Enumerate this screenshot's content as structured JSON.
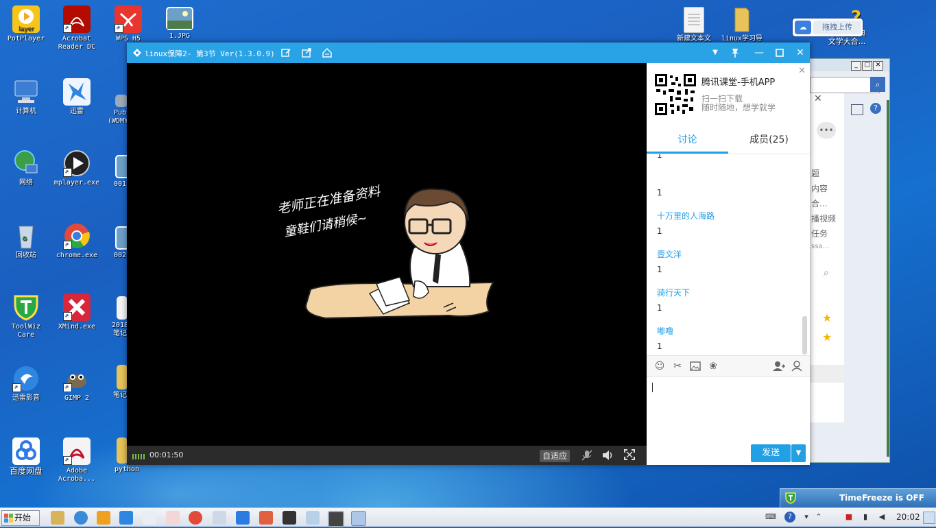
{
  "desktop_icons": [
    {
      "label": "PotPlayer",
      "icon": "potplayer-icon",
      "color": "#f7c51a"
    },
    {
      "label": "Acrobat\nReader DC",
      "icon": "acrobat-icon",
      "color": "#b30b00"
    },
    {
      "label": "WPS H5",
      "icon": "wps-icon",
      "color": "#e8352d"
    },
    {
      "label": "1.JPG",
      "icon": "image-file-icon",
      "color": "#6ca0c8"
    },
    {
      "label": "新建文本文",
      "icon": "text-file-icon",
      "color": "#f4f4f4"
    },
    {
      "label": "linux学习导",
      "icon": "folder-icon",
      "color": "#e8c35b"
    },
    {
      "label": "《中国古典\n文学大合...",
      "icon": "help-file-icon",
      "color": "#f2c21b"
    },
    {
      "label": "计算机",
      "icon": "computer-icon",
      "color": "#3b7ed4"
    },
    {
      "label": "迅雷",
      "icon": "xunlei-icon",
      "color": "#2f86e0"
    },
    {
      "label": "Pub\n(WDMYC",
      "icon": "network-share-icon",
      "color": "#9ab"
    },
    {
      "label": "网络",
      "icon": "network-icon",
      "color": "#3b9e48"
    },
    {
      "label": "mplayer.exe",
      "icon": "mplayer-icon",
      "color": "#222222"
    },
    {
      "label": "001",
      "icon": "image-file-icon",
      "color": "#6ca0c8"
    },
    {
      "label": "回收站",
      "icon": "recycle-bin-icon",
      "color": "#c8d8e8"
    },
    {
      "label": "chrome.exe",
      "icon": "chrome-icon",
      "color": "#e24a3b"
    },
    {
      "label": "002",
      "icon": "image-file-icon",
      "color": "#6ca0c8"
    },
    {
      "label": "ToolWiz\nCare",
      "icon": "toolwiz-icon",
      "color": "#2aa845"
    },
    {
      "label": "XMind.exe",
      "icon": "xmind-icon",
      "color": "#d8263a"
    },
    {
      "label": "2018\n笔记",
      "icon": "doc-file-icon",
      "color": "#f4f4f4"
    },
    {
      "label": "迅雷影音",
      "icon": "xunlei-player-icon",
      "color": "#2f86e0"
    },
    {
      "label": "GIMP 2",
      "icon": "gimp-icon",
      "color": "#7a6a4f"
    },
    {
      "label": "笔记",
      "icon": "folder-icon",
      "color": "#e8c35b"
    },
    {
      "label": "百度网盘",
      "icon": "baidu-pan-icon",
      "color": "#2f7ae6"
    },
    {
      "label": "Adobe\nAcroba...",
      "icon": "acrobat-icon",
      "color": "#f4f4f4"
    },
    {
      "label": "python",
      "icon": "folder-icon",
      "color": "#e8c35b"
    }
  ],
  "upload_widget": {
    "label": "拖拽上传"
  },
  "app_window": {
    "title": "linux保障2- 第3节 Ver(1.3.0.9)",
    "video": {
      "notice_line1": "老师正在准备资料",
      "notice_line2": "童鞋们请稍候~",
      "time": "00:01:50",
      "fit_label": "自适应"
    },
    "side_panel": {
      "app_name": "腾讯课堂-手机APP",
      "sub1": "扫一扫下载",
      "sub2": "随时随地，想学就学",
      "tabs": [
        {
          "label": "讨论",
          "active": true
        },
        {
          "label": "成员(25)",
          "active": false
        }
      ],
      "messages": [
        {
          "name": "",
          "text": "1"
        },
        {
          "name": "",
          "text": "1"
        },
        {
          "name": "十万里的人海路",
          "text": "1"
        },
        {
          "name": "壹文洋",
          "text": "1"
        },
        {
          "name": "骑行天下",
          "text": "1"
        },
        {
          "name": "嘟噜",
          "text": "1"
        }
      ],
      "send_label": "发送"
    }
  },
  "bg_window": {
    "items": [
      "题",
      "内容",
      "合...",
      "播视频",
      "任务",
      "ssa..."
    ]
  },
  "timefreeze": {
    "label": "TimeFreeze is OFF"
  },
  "taskbar": {
    "start_label": "开始",
    "clock": "20:02"
  },
  "colors": {
    "accent": "#22a0e6",
    "titlebar": "#2aa3e6"
  }
}
